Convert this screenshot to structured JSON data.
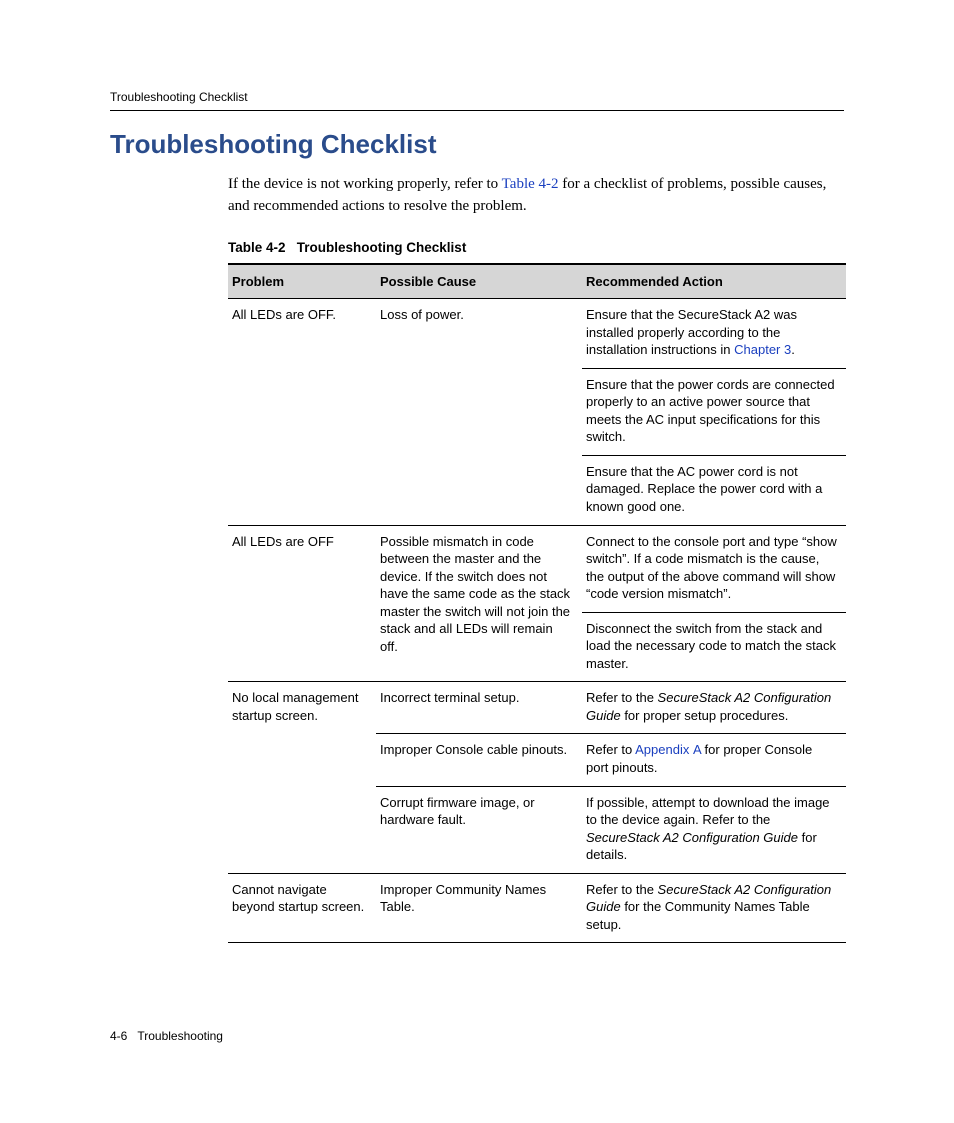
{
  "runningHeader": "Troubleshooting Checklist",
  "heading": "Troubleshooting Checklist",
  "intro": {
    "pre": "If the device is not working properly, refer to ",
    "link": "Table 4-2",
    "post": " for a checklist of problems, possible causes, and recommended actions to resolve the problem."
  },
  "tableCaption": {
    "label": "Table 4-2",
    "title": "Troubleshooting Checklist"
  },
  "columns": {
    "problem": "Problem",
    "cause": "Possible Cause",
    "action": "Recommended Action"
  },
  "rows": {
    "r1": {
      "problem": "All LEDs are OFF.",
      "cause": "Loss of power.",
      "action_a_pre": "Ensure that the SecureStack A2 was installed properly according to the installation instructions in ",
      "action_a_link": "Chapter 3",
      "action_a_post": ".",
      "action_b": "Ensure that the power cords are connected properly to an active power source that meets the AC input specifications for this switch.",
      "action_c": "Ensure that the AC power cord is not damaged. Replace the power cord with a known good one."
    },
    "r2": {
      "problem": "All LEDs are OFF",
      "cause": "Possible mismatch in code between the master and the device. If the switch does not have the same code as the stack master the switch will not join the stack and all LEDs will remain off.",
      "action_a": "Connect to the console port and type “show switch”. If a code mismatch is the cause, the output of the above command will show “code version mismatch”.",
      "action_b": "Disconnect the switch from the stack and load the necessary code to match the stack master."
    },
    "r3": {
      "problem": "No local management startup screen.",
      "cause_a": "Incorrect terminal setup.",
      "action_a_pre": "Refer to the ",
      "action_a_ital": "SecureStack A2 Configuration Guide",
      "action_a_post": " for proper setup procedures.",
      "cause_b": "Improper Console cable pinouts.",
      "action_b_pre": "Refer to ",
      "action_b_link": "Appendix A",
      "action_b_post": " for proper Console port pinouts.",
      "cause_c": "Corrupt firmware image, or hardware fault.",
      "action_c_pre": "If possible, attempt to download the image to the device again. Refer to the ",
      "action_c_ital": "SecureStack A2 Configuration Guide",
      "action_c_post": " for details."
    },
    "r4": {
      "problem": "Cannot navigate beyond startup screen.",
      "cause": "Improper Community Names Table.",
      "action_pre": "Refer to the ",
      "action_ital": "SecureStack A2 Configuration Guide",
      "action_post": " for the Community Names Table setup."
    }
  },
  "footer": {
    "page": "4-6",
    "section": "Troubleshooting"
  }
}
